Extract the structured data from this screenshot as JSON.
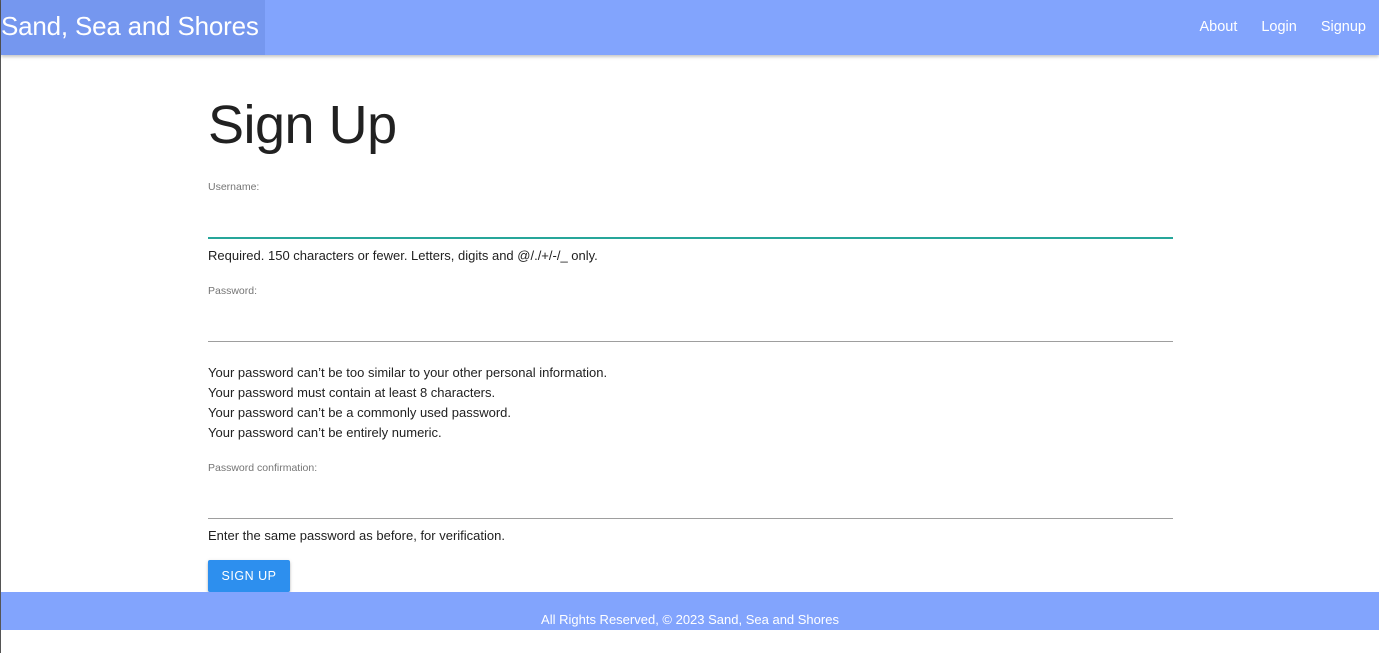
{
  "navbar": {
    "brand": "Sand, Sea and Shores",
    "links": [
      {
        "label": "About"
      },
      {
        "label": "Login"
      },
      {
        "label": "Signup"
      }
    ]
  },
  "form": {
    "title": "Sign Up",
    "username": {
      "label": "Username:",
      "value": "",
      "help": "Required. 150 characters or fewer. Letters, digits and @/./+/-/_ only."
    },
    "password": {
      "label": "Password:",
      "value": "",
      "help": [
        "Your password can’t be too similar to your other personal information.",
        "Your password must contain at least 8 characters.",
        "Your password can’t be a commonly used password.",
        "Your password can’t be entirely numeric."
      ]
    },
    "password_confirmation": {
      "label": "Password confirmation:",
      "value": "",
      "help": "Enter the same password as before, for verification."
    },
    "submit_label": "SIGN UP"
  },
  "footer": {
    "text": "All Rights Reserved, © 2023 Sand, Sea and Shores"
  },
  "colors": {
    "navbar": "#82a4fd",
    "brand_bg": "#7597ef",
    "active_underline": "#26a69a",
    "button": "#2d8fee"
  }
}
